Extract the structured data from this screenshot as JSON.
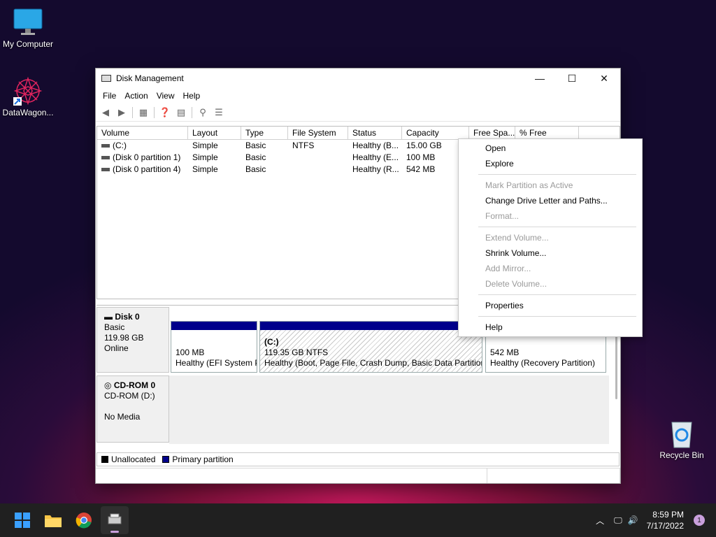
{
  "desktop": {
    "icons": [
      {
        "label": "My Computer"
      },
      {
        "label": "DataWagon..."
      },
      {
        "label": "Recycle Bin"
      }
    ]
  },
  "window": {
    "title": "Disk Management",
    "controls": {
      "minimize": "—",
      "maximize": "☐",
      "close": "✕"
    },
    "menu": [
      "File",
      "Action",
      "View",
      "Help"
    ]
  },
  "volumes": {
    "columns": [
      "Volume",
      "Layout",
      "Type",
      "File System",
      "Status",
      "Capacity",
      "Free Spa...",
      "% Free"
    ],
    "rows": [
      [
        "(C:)",
        "Simple",
        "Basic",
        "NTFS",
        "Healthy (B...",
        "15.00 GB"
      ],
      [
        "(Disk 0 partition 1)",
        "Simple",
        "Basic",
        "",
        "Healthy (E...",
        "100 MB"
      ],
      [
        "(Disk 0 partition 4)",
        "Simple",
        "Basic",
        "",
        "Healthy (R...",
        "542 MB"
      ]
    ]
  },
  "disks": {
    "disk0": {
      "name": "Disk 0",
      "type": "Basic",
      "size": "119.98 GB",
      "status": "Online",
      "partitions": [
        {
          "line1": "",
          "line2": "100 MB",
          "line3": "Healthy (EFI System P"
        },
        {
          "line1": "(C:)",
          "line2": "119.35 GB NTFS",
          "line3": "Healthy (Boot, Page File, Crash Dump, Basic Data Partition"
        },
        {
          "line1": "",
          "line2": "542 MB",
          "line3": "Healthy (Recovery Partition)"
        }
      ]
    },
    "cdrom0": {
      "name": "CD-ROM 0",
      "drive": "CD-ROM (D:)",
      "media": "No Media"
    }
  },
  "legend": {
    "unallocated": "Unallocated",
    "primary": "Primary partition",
    "unallocated_color": "#000000",
    "primary_color": "#00008b"
  },
  "context_menu": {
    "items": [
      {
        "label": "Open",
        "enabled": true
      },
      {
        "label": "Explore",
        "enabled": true
      },
      {
        "label": "Mark Partition as Active",
        "enabled": false
      },
      {
        "label": "Change Drive Letter and Paths...",
        "enabled": true
      },
      {
        "label": "Format...",
        "enabled": false
      },
      {
        "label": "Extend Volume...",
        "enabled": false
      },
      {
        "label": "Shrink Volume...",
        "enabled": true
      },
      {
        "label": "Add Mirror...",
        "enabled": false
      },
      {
        "label": "Delete Volume...",
        "enabled": false
      },
      {
        "label": "Properties",
        "enabled": true
      },
      {
        "label": "Help",
        "enabled": true
      }
    ]
  },
  "taskbar": {
    "time": "8:59 PM",
    "date": "7/17/2022",
    "notifications": "1"
  }
}
